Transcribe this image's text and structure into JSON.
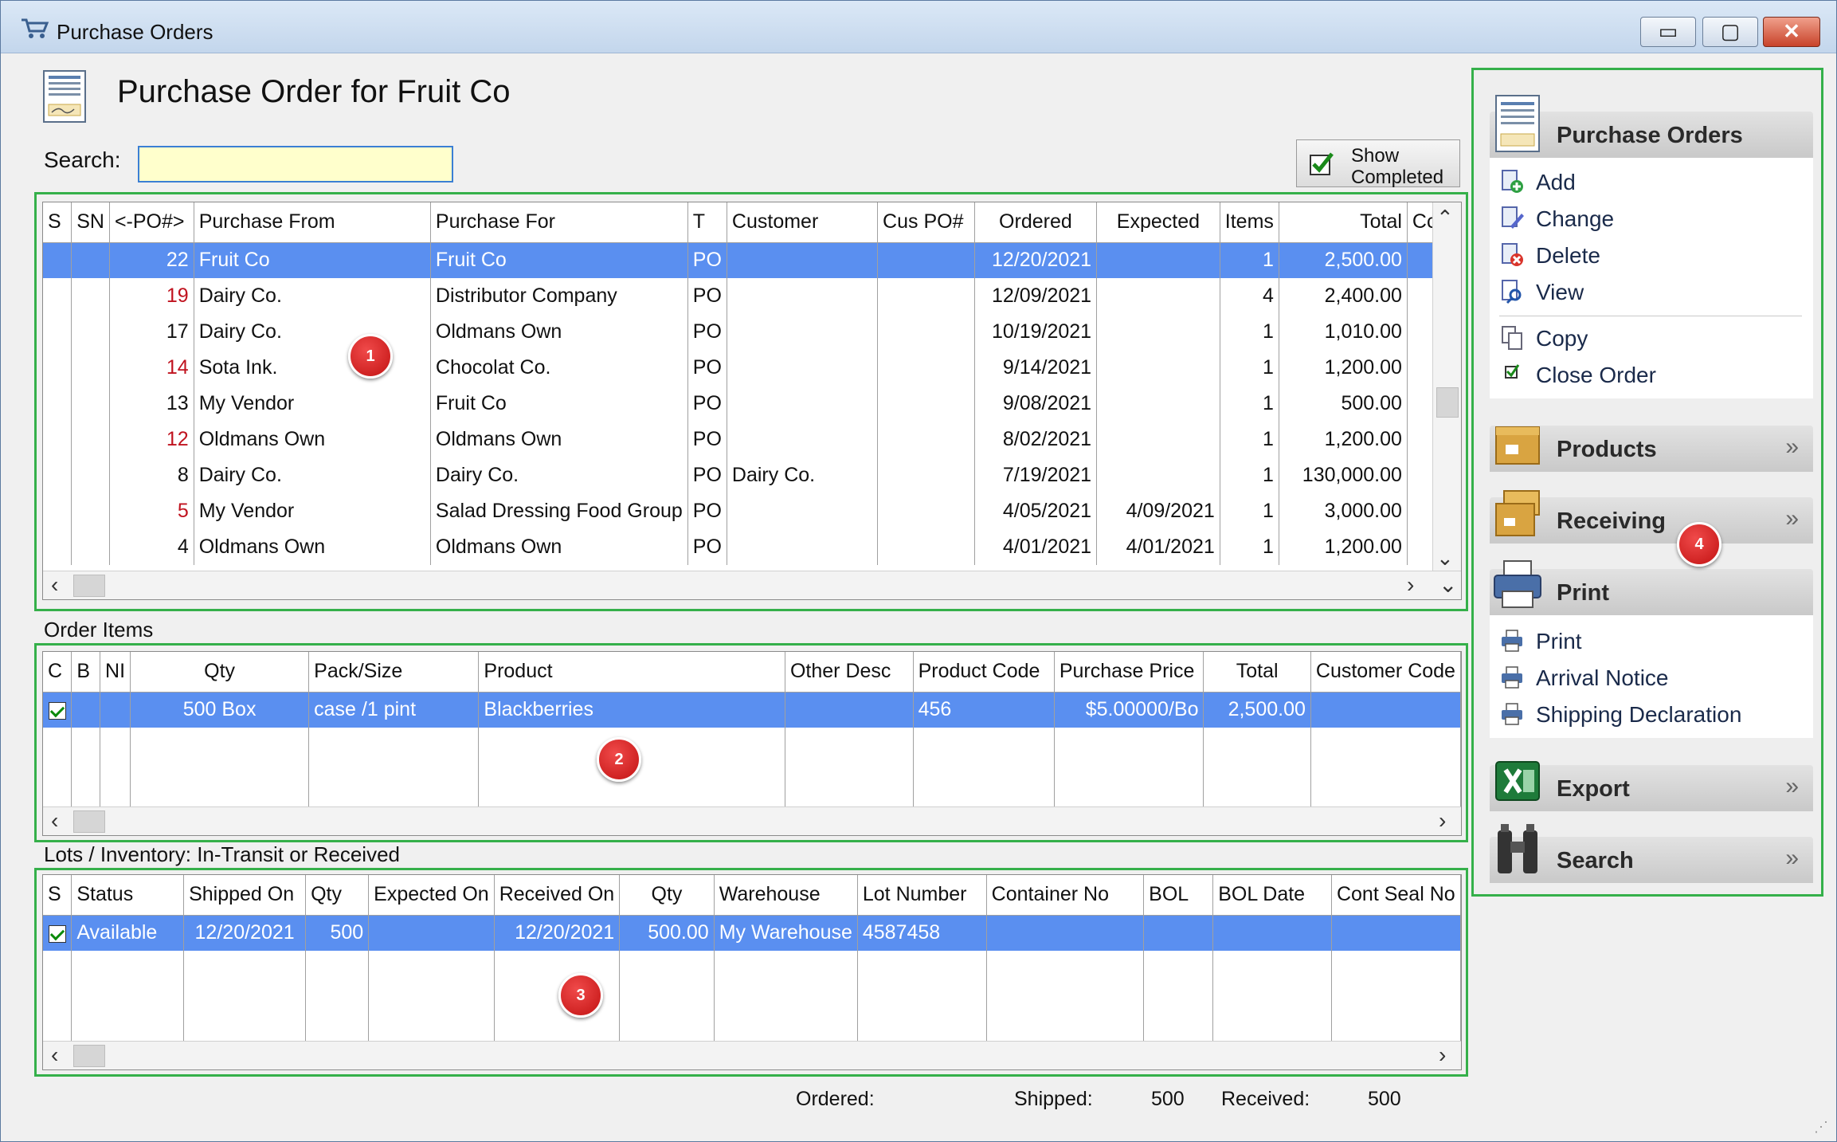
{
  "window": {
    "title": "Purchase Orders"
  },
  "header": {
    "page_title": "Purchase Order for Fruit Co",
    "search_label": "Search:",
    "search_value": "",
    "show_completed_line1": "Show",
    "show_completed_line2": "Completed"
  },
  "po_grid": {
    "columns": [
      "S",
      "SN",
      "<-PO#>",
      "Purchase From",
      "Purchase For",
      "T",
      "Customer",
      "Cus PO#",
      "Ordered",
      "Expected",
      "Items",
      "Total",
      "Cc"
    ],
    "rows": [
      {
        "po": "22",
        "from": "Fruit Co",
        "for": "Fruit Co",
        "t": "PO",
        "customer": "",
        "cuspo": "",
        "ordered": "12/20/2021",
        "expected": "",
        "items": "1",
        "total": "2,500.00",
        "red": false,
        "selected": true
      },
      {
        "po": "19",
        "from": "Dairy Co.",
        "for": "Distributor Company",
        "t": "PO",
        "customer": "",
        "cuspo": "",
        "ordered": "12/09/2021",
        "expected": "",
        "items": "4",
        "total": "2,400.00",
        "red": true,
        "selected": false
      },
      {
        "po": "17",
        "from": "Dairy Co.",
        "for": "Oldmans Own",
        "t": "PO",
        "customer": "",
        "cuspo": "",
        "ordered": "10/19/2021",
        "expected": "",
        "items": "1",
        "total": "1,010.00",
        "red": false,
        "selected": false
      },
      {
        "po": "14",
        "from": "Sota Ink.",
        "for": "Chocolat Co.",
        "t": "PO",
        "customer": "",
        "cuspo": "",
        "ordered": "9/14/2021",
        "expected": "",
        "items": "1",
        "total": "1,200.00",
        "red": true,
        "selected": false
      },
      {
        "po": "13",
        "from": "My Vendor",
        "for": "Fruit Co",
        "t": "PO",
        "customer": "",
        "cuspo": "",
        "ordered": "9/08/2021",
        "expected": "",
        "items": "1",
        "total": "500.00",
        "red": false,
        "selected": false
      },
      {
        "po": "12",
        "from": "Oldmans Own",
        "for": "Oldmans Own",
        "t": "PO",
        "customer": "",
        "cuspo": "",
        "ordered": "8/02/2021",
        "expected": "",
        "items": "1",
        "total": "1,200.00",
        "red": true,
        "selected": false
      },
      {
        "po": "8",
        "from": "Dairy Co.",
        "for": "Dairy Co.",
        "t": "PO",
        "customer": "Dairy Co.",
        "cuspo": "",
        "ordered": "7/19/2021",
        "expected": "",
        "items": "1",
        "total": "130,000.00",
        "red": false,
        "selected": false
      },
      {
        "po": "5",
        "from": "My Vendor",
        "for": "Salad Dressing Food Group",
        "t": "PO",
        "customer": "",
        "cuspo": "",
        "ordered": "4/05/2021",
        "expected": "4/09/2021",
        "items": "1",
        "total": "3,000.00",
        "red": true,
        "selected": false
      },
      {
        "po": "4",
        "from": "Oldmans Own",
        "for": "Oldmans Own",
        "t": "PO",
        "customer": "",
        "cuspo": "",
        "ordered": "4/01/2021",
        "expected": "4/01/2021",
        "items": "1",
        "total": "1,200.00",
        "red": false,
        "selected": false
      }
    ]
  },
  "order_items": {
    "label": "Order Items",
    "columns": [
      "C",
      "B",
      "NI",
      "Qty",
      "Pack/Size",
      "Product",
      "Other Desc",
      "Product Code",
      "Purchase Price",
      "Total",
      "Customer Code"
    ],
    "rows": [
      {
        "qty": "500 Box",
        "pack": "case /1 pint",
        "product": "Blackberries",
        "other": "",
        "code": "456",
        "price": "$5.00000/Bo",
        "total": "2,500.00",
        "custcode": ""
      }
    ]
  },
  "lots": {
    "label": "Lots / Inventory: In-Transit or Received",
    "columns": [
      "S",
      "Status",
      "Shipped On",
      "Qty",
      "Expected On",
      "Received On",
      "Qty",
      "Warehouse",
      "Lot Number",
      "Container No",
      "BOL",
      "BOL Date",
      "Cont Seal No"
    ],
    "rows": [
      {
        "status": "Available",
        "shipped": "12/20/2021",
        "qty": "500",
        "expected": "",
        "received": "12/20/2021",
        "qty2": "500.00",
        "warehouse": "My Warehouse",
        "lot": "4587458",
        "container": "",
        "bol": "",
        "boldate": "",
        "seal": ""
      }
    ]
  },
  "status_bar": {
    "ordered_label": "Ordered:",
    "ordered_value": "",
    "shipped_label": "Shipped:",
    "shipped_value": "500",
    "received_label": "Received:",
    "received_value": "500"
  },
  "sidebar": {
    "purchase_orders": {
      "title": "Purchase Orders",
      "items": [
        "Add",
        "Change",
        "Delete",
        "View",
        "Copy",
        "Close Order"
      ]
    },
    "products": {
      "title": "Products"
    },
    "receiving": {
      "title": "Receiving"
    },
    "print": {
      "title": "Print",
      "items": [
        "Print",
        "Arrival Notice",
        "Shipping Declaration"
      ]
    },
    "export": {
      "title": "Export"
    },
    "search": {
      "title": "Search"
    }
  },
  "badges": [
    "1",
    "2",
    "3",
    "4"
  ],
  "colors": {
    "selection": "#5a8ff0",
    "frame": "#35b04a",
    "alert_red": "#c0131f"
  }
}
